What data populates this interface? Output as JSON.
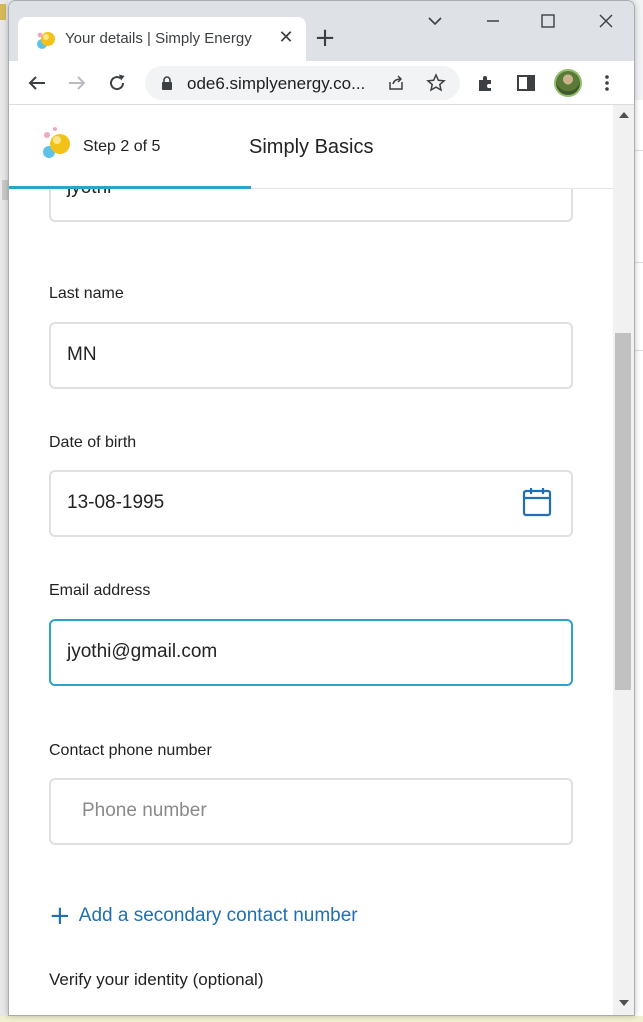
{
  "browser": {
    "tab_title": "Your details | Simply Energy",
    "tab_close": "✕",
    "new_tab": "+",
    "url": "ode6.simplyenergy.co...",
    "icons": [
      "back-icon",
      "forward-icon",
      "reload-icon",
      "lock-icon",
      "share-icon",
      "star-icon",
      "extensions-icon",
      "sidepanel-icon",
      "profile-avatar",
      "menu-icon",
      "chevron-down-icon",
      "minimize-icon",
      "maximize-icon",
      "close-icon"
    ]
  },
  "stepper": {
    "step_label": "Step 2 of 5",
    "title": "Simply Basics",
    "progress_fraction": 0.4
  },
  "form": {
    "first_name_value": "jyothi",
    "last_name": {
      "label": "Last name",
      "value": "MN"
    },
    "dob": {
      "label": "Date of birth",
      "value": "13-08-1995"
    },
    "email": {
      "label": "Email address",
      "value": "jyothi@gmail.com"
    },
    "phone": {
      "label": "Contact phone number",
      "placeholder": "Phone number"
    },
    "add_secondary": "Add a secondary contact number",
    "add_secondary_plus": "+",
    "verify_heading": "Verify your identity (optional)"
  },
  "colors": {
    "accent": "#2ea3c8",
    "link": "#1f6fb2",
    "field_border": "#e0e0e0"
  }
}
